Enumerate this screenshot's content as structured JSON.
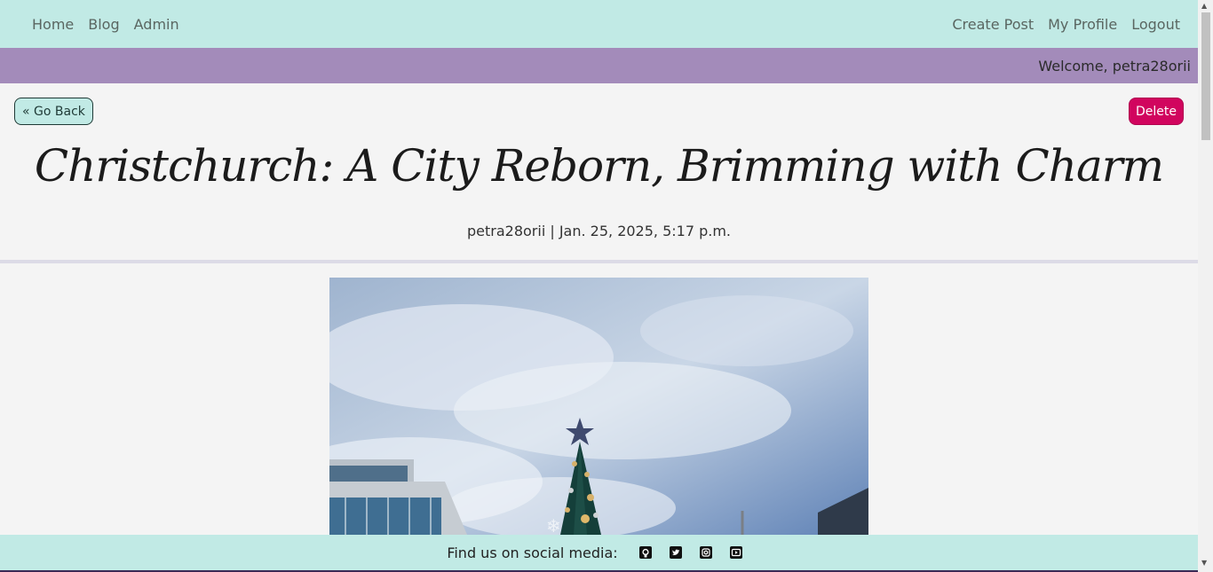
{
  "nav": {
    "left": [
      "Home",
      "Blog",
      "Admin"
    ],
    "right": [
      "Create Post",
      "My Profile",
      "Logout"
    ]
  },
  "welcome": "Welcome, petra28orii",
  "actions": {
    "go_back": "« Go Back",
    "delete": "Delete"
  },
  "post": {
    "title": "Christchurch: A City Reborn, Brimming with Charm",
    "meta": "petra28orii | Jan. 25, 2025, 5:17 p.m."
  },
  "footer": {
    "label": "Find us on social media:",
    "icons": [
      "github-icon",
      "twitter-icon",
      "instagram-icon",
      "youtube-icon"
    ]
  },
  "colors": {
    "navbar": "#c1eae5",
    "welcome_bar": "#a38bba",
    "delete": "#d1055e",
    "page_bg": "#f4f4f4"
  }
}
